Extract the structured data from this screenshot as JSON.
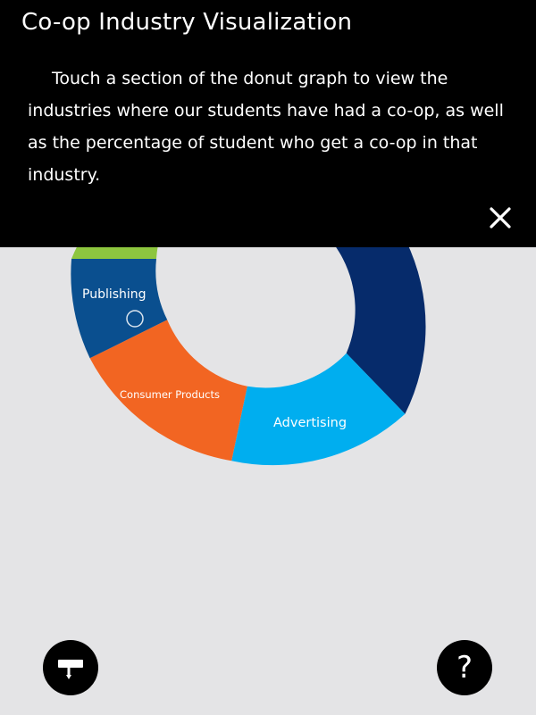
{
  "overlay": {
    "title": "Co-op Industry Visualization",
    "body": "Touch a section of the donut graph to view the industries where our students have had a co-op, as well as the percentage of student who get a co-op in that industry."
  },
  "chart_data": {
    "type": "pie",
    "categories": [
      "Publishing",
      "Consumer Products",
      "Advertising"
    ],
    "colors": {
      "publishing": "#0a4f8f",
      "consumer_products": "#f26522",
      "advertising": "#00aeef",
      "navy": "#062b6b",
      "green": "#8dc63f"
    }
  },
  "icons": {
    "close": "close-icon",
    "filter": "filter-icon",
    "help": "question-mark-icon"
  },
  "help_glyph": "?"
}
